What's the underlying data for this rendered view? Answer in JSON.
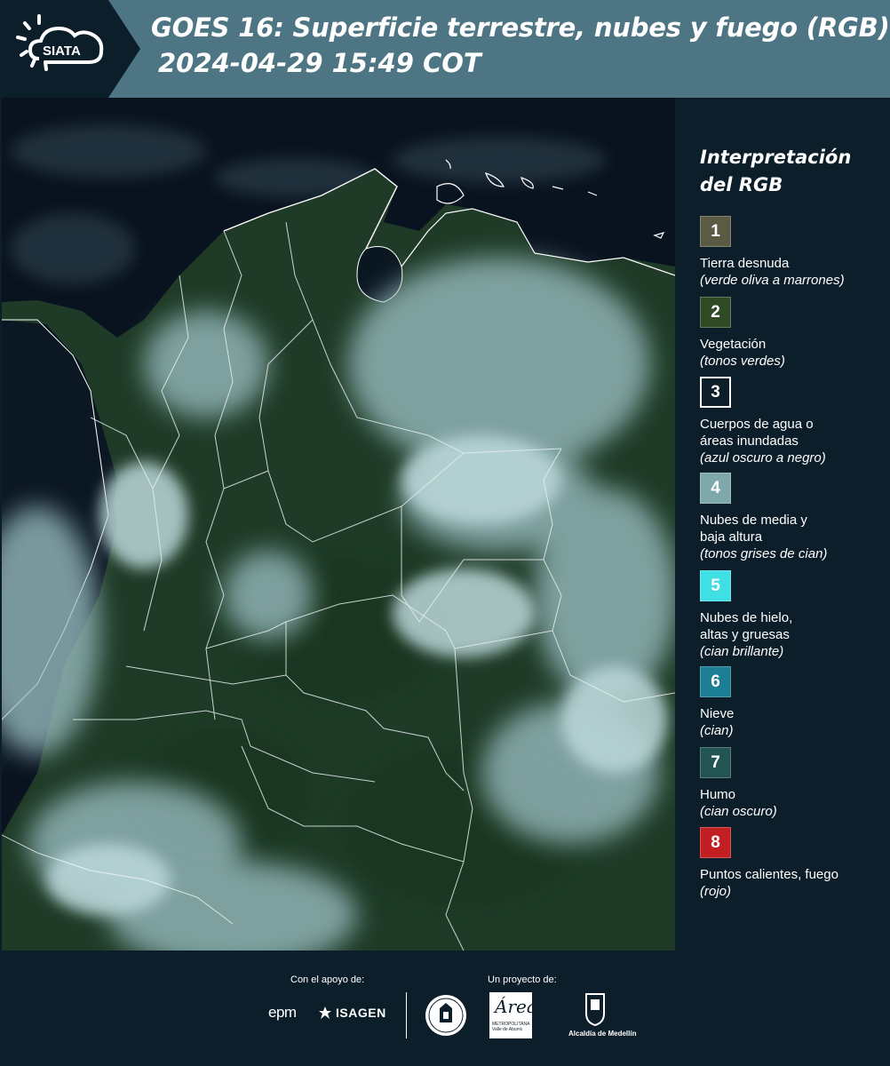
{
  "header": {
    "logo_text": "SIATA",
    "title_line1": "GOES 16: Superficie terrestre, nubes y fuego (RGB)",
    "title_line2": "2024-04-29 15:49 COT"
  },
  "map": {
    "description_icon": "satellite-rgb-image",
    "ocean_color": "#09131f",
    "land_color": "#1f3b27",
    "cloud_color": "#a6c9cd",
    "border_color": "#ffffff"
  },
  "legend": {
    "title_line1": "Interpretación",
    "title_line2": "del RGB",
    "items": [
      {
        "number": "1",
        "label": "Tierra desnuda",
        "note": "(verde oliva a marrones)",
        "color": "#5b5b43"
      },
      {
        "number": "2",
        "label": "Vegetación",
        "note": "(tonos verdes)",
        "color": "#2f4a24"
      },
      {
        "number": "3",
        "label_line1": "Cuerpos de agua o",
        "label_line2": "áreas inundadas",
        "note": "(azul oscuro a negro)",
        "color": "#0d1e2b"
      },
      {
        "number": "4",
        "label_line1": "Nubes de media y",
        "label_line2": "baja altura",
        "note": "(tonos grises de cian)",
        "color": "#7fa8aa"
      },
      {
        "number": "5",
        "label_line1": "Nubes de hielo,",
        "label_line2": "altas y gruesas",
        "note": "(cian brillante)",
        "color": "#3ee0e6"
      },
      {
        "number": "6",
        "label": "Nieve",
        "note": "(cian)",
        "color": "#1c7e94"
      },
      {
        "number": "7",
        "label": "Humo",
        "note": "(cian oscuro)",
        "color": "#215453"
      },
      {
        "number": "8",
        "label": "Puntos calientes, fuego",
        "note": "(rojo)",
        "color": "#c21f22"
      }
    ]
  },
  "footer": {
    "support_caption": "Con el apoyo de:",
    "project_caption": "Un proyecto de:",
    "sponsor_epm": "epm",
    "sponsor_isagen": "ISAGEN",
    "area_logo_word": "Área",
    "area_logo_sub_1": "METROPOLITANA",
    "area_logo_sub_2": "Valle de Aburrá",
    "medellin": "Alcaldía de Medellín"
  }
}
